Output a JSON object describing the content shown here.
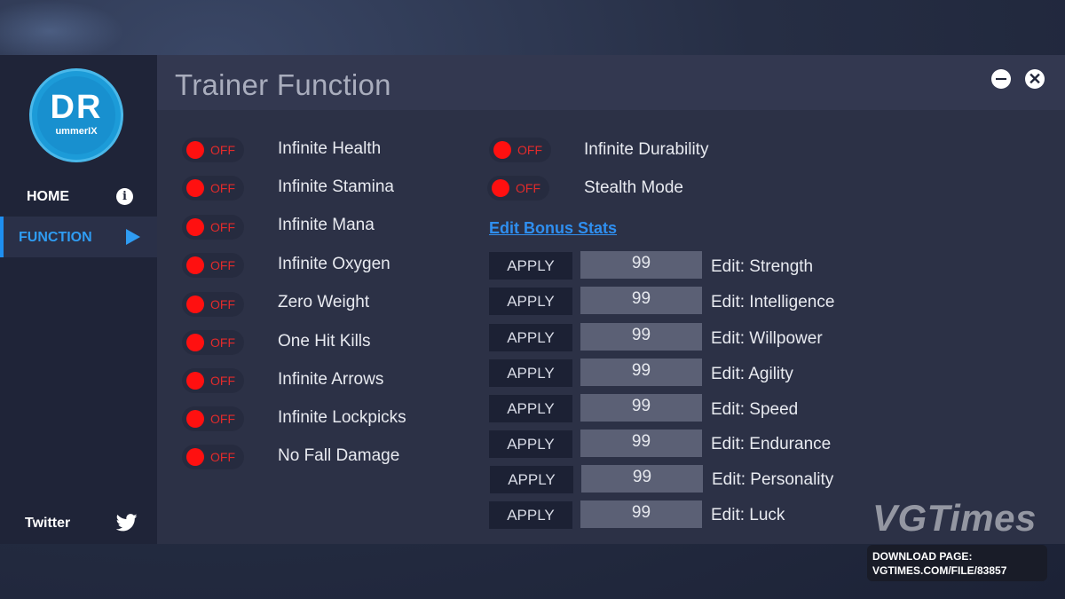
{
  "header": {
    "title": "Trainer Function"
  },
  "logo": {
    "main": "DR",
    "sub": "ummerIX"
  },
  "nav": {
    "home": "HOME",
    "function": "FUNCTION",
    "twitter": "Twitter"
  },
  "toggle_state_label": "OFF",
  "options_left": [
    {
      "label": "Infinite Health",
      "state": "OFF"
    },
    {
      "label": "Infinite Stamina",
      "state": "OFF"
    },
    {
      "label": "Infinite Mana",
      "state": "OFF"
    },
    {
      "label": "Infinite Oxygen",
      "state": "OFF"
    },
    {
      "label": "Zero Weight",
      "state": "OFF"
    },
    {
      "label": "One Hit Kills",
      "state": "OFF"
    },
    {
      "label": "Infinite Arrows",
      "state": "OFF"
    },
    {
      "label": "Infinite Lockpicks",
      "state": "OFF"
    },
    {
      "label": "No Fall Damage",
      "state": "OFF"
    }
  ],
  "options_right": [
    {
      "label": "Infinite Durability",
      "state": "OFF"
    },
    {
      "label": "Stealth Mode",
      "state": "OFF"
    }
  ],
  "bonus": {
    "link": "Edit Bonus Stats",
    "apply_label": "APPLY",
    "stats": [
      {
        "value": "99",
        "label": "Edit: Strength"
      },
      {
        "value": "99",
        "label": "Edit: Intelligence"
      },
      {
        "value": "99",
        "label": "Edit: Willpower"
      },
      {
        "value": "99",
        "label": "Edit: Agility"
      },
      {
        "value": "99",
        "label": "Edit: Speed"
      },
      {
        "value": "99",
        "label": "Edit: Endurance"
      },
      {
        "value": "99",
        "label": "Edit: Personality"
      },
      {
        "value": "99",
        "label": "Edit: Luck"
      }
    ]
  },
  "watermark": {
    "brand": "VGTimes",
    "line1": "DOWNLOAD PAGE:",
    "line2": "VGTIMES.COM/FILE/83857"
  },
  "colors": {
    "accent": "#2f9cf2",
    "toggle_off": "#ff1010",
    "sidebar": "#1f2438",
    "content": "#2c3146"
  },
  "icons": [
    "info-icon",
    "play-icon",
    "twitter-bird-icon",
    "minimize-icon",
    "close-icon"
  ]
}
